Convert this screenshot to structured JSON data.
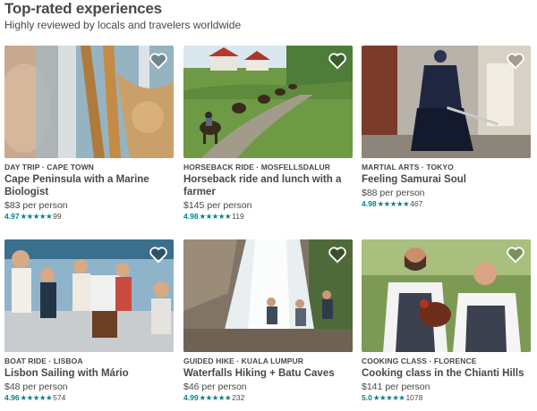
{
  "header": {
    "title": "Top-rated experiences",
    "subtitle": "Highly reviewed by locals and travelers worldwide"
  },
  "colors": {
    "rating": "#008489",
    "text": "#484848"
  },
  "icons": {
    "save": "heart-icon",
    "star": "star-icon"
  },
  "cards": [
    {
      "kicker": "DAY TRIP · CAPE TOWN",
      "title": "Cape Peninsula with a Marine Biologist",
      "price": "$83 per person",
      "score": "4.97",
      "stars": "★★★★★",
      "reviews": "99"
    },
    {
      "kicker": "HORSEBACK RIDE · MOSFELLSDALUR",
      "title": "Horseback ride and lunch with a farmer",
      "price": "$145 per person",
      "score": "4.98",
      "stars": "★★★★★",
      "reviews": "119"
    },
    {
      "kicker": "MARTIAL ARTS · TOKYO",
      "title": "Feeling Samurai Soul",
      "price": "$88 per person",
      "score": "4.98",
      "stars": "★★★★★",
      "reviews": "467"
    },
    {
      "kicker": "BOAT RIDE · LISBOA",
      "title": "Lisbon Sailing with Mário",
      "price": "$48 per person",
      "score": "4.96",
      "stars": "★★★★★",
      "reviews": "574"
    },
    {
      "kicker": "GUIDED HIKE · KUALA LUMPUR",
      "title": "Waterfalls Hiking + Batu Caves",
      "price": "$46 per person",
      "score": "4.99",
      "stars": "★★★★★",
      "reviews": "232"
    },
    {
      "kicker": "COOKING CLASS · FLORENCE",
      "title": "Cooking class in the Chianti Hills",
      "price": "$141 per person",
      "score": "5.0",
      "stars": "★★★★★",
      "reviews": "1078"
    }
  ]
}
